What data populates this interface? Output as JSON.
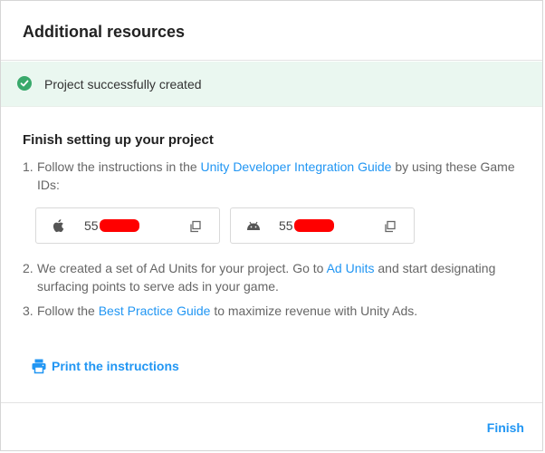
{
  "dialog": {
    "title": "Additional resources",
    "banner": {
      "message": "Project successfully created"
    },
    "section_title": "Finish setting up your project",
    "steps": [
      {
        "num": "1.",
        "before": "Follow the instructions in the ",
        "link": "Unity Developer Integration Guide",
        "after": " by using these Game IDs:"
      },
      {
        "num": "2.",
        "before": "We created a set of Ad Units for your project. Go to ",
        "link": "Ad Units",
        "after": " and start designating surfacing points to serve ads in your game."
      },
      {
        "num": "3.",
        "before": "Follow the ",
        "link": "Best Practice Guide",
        "after": " to maximize revenue with Unity Ads."
      }
    ],
    "game_ids": [
      {
        "platform": "ios",
        "icon": "apple-icon",
        "visible_id": "55"
      },
      {
        "platform": "android",
        "icon": "android-icon",
        "visible_id": "55"
      }
    ],
    "print_label": "Print the instructions",
    "finish_label": "Finish"
  },
  "colors": {
    "accent": "#2196f3",
    "success": "#39a96b",
    "banner_bg": "#eaf7f0",
    "redaction": "#ff0000"
  }
}
